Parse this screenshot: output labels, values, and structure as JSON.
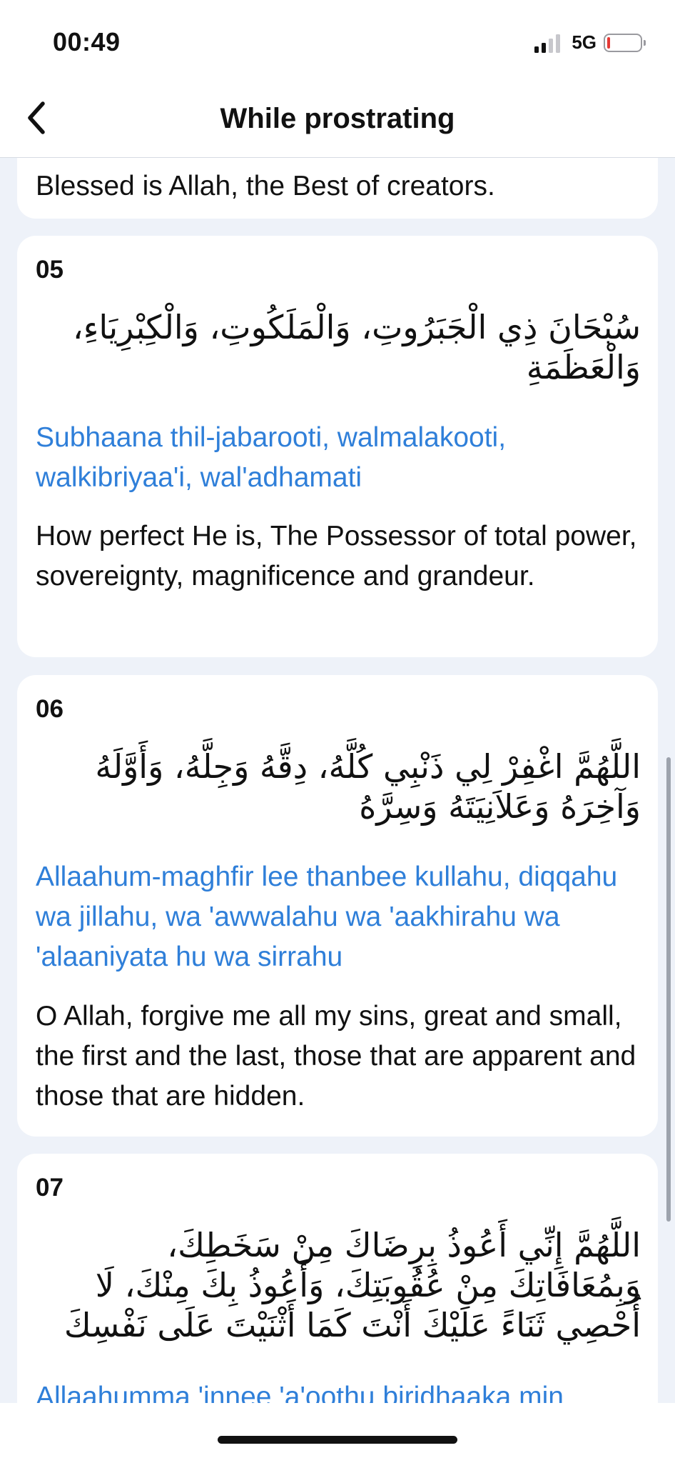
{
  "status_bar": {
    "time": "00:49",
    "network": "5G",
    "battery_color": "#e53935"
  },
  "nav": {
    "back_icon": "chevron-left-icon",
    "title": "While prostrating"
  },
  "colors": {
    "background": "#eef2f9",
    "card": "#ffffff",
    "transliteration": "#2f7fd9",
    "text": "#111111"
  },
  "cards": [
    {
      "translation": "Blessed is Allah, the Best of creators."
    },
    {
      "number": "05",
      "arabic": "سُبْحَانَ ذِي الْجَبَرُوتِ، وَالْمَلَكُوتِ، وَالْكِبْرِيَاءِ، وَالْعَظَمَةِ",
      "transliteration": "Subhaana thil-jabarooti, walmalakooti, walkibriyaa'i, wal'adhamati",
      "translation": "How perfect He is, The Possessor of total power, sovereignty, magnificence and grandeur."
    },
    {
      "number": "06",
      "arabic": "اللَّهُمَّ اغْفِرْ لِي ذَنْبِي كُلَّهُ، دِقَّهُ وَجِلَّهُ، وَأَوَّلَهُ وَآخِرَهُ وَعَلاَنِيَتَهُ وَسِرَّهُ",
      "transliteration": "Allaahum-maghfir lee thanbee kullahu, diqqahu wa jillahu, wa 'awwalahu wa 'aakhirahu wa 'alaaniyata hu wa sirrahu",
      "translation": "O Allah, forgive me all my sins, great and small, the first and the last, those that are apparent and those that are hidden."
    },
    {
      "number": "07",
      "arabic": "اللَّهُمَّ إِنِّي أَعُوذُ بِرِضَاكَ مِنْ سَخَطِكَ، وَبِمُعَافَاتِكَ مِنْ عُقُوبَتِكَ، وَأَعُوذُ بِكَ مِنْكَ، لَا أُحْصِي ثَنَاءً عَلَيْكَ أَنْتَ كَمَا أَثْنَيْتَ عَلَى نَفْسِكَ",
      "transliteration": "Allaahumma 'innee 'a'oothu biridhaaka min"
    }
  ]
}
